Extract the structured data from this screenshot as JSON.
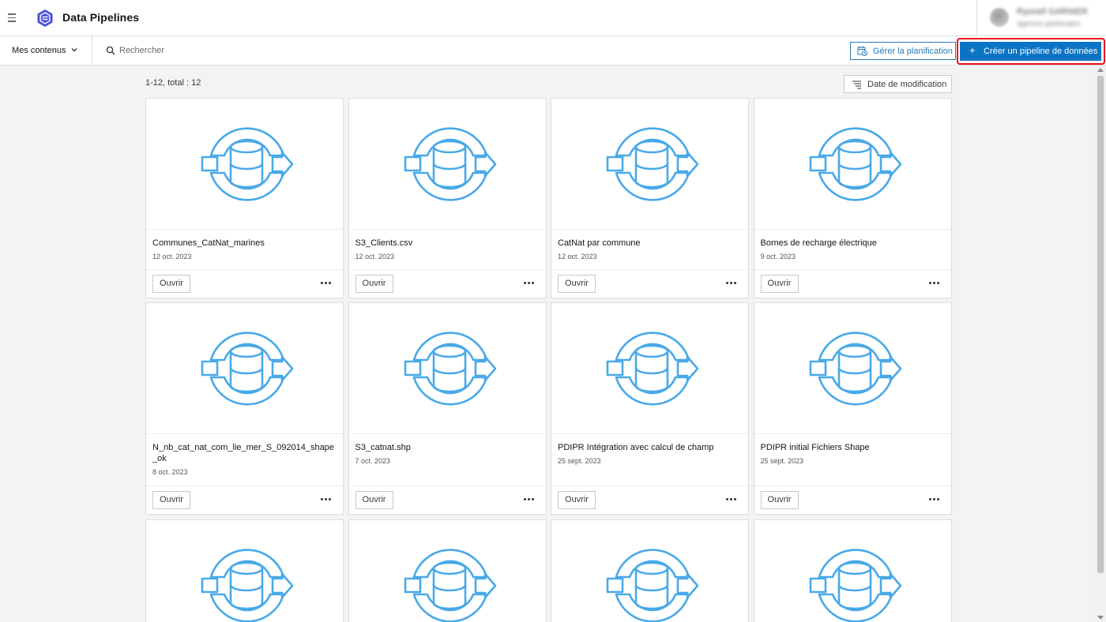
{
  "app": {
    "title": "Data Pipelines",
    "logo_icon": "data-pipelines-hexagon-icon",
    "brand_color": "#4b4fd6"
  },
  "user": {
    "name": "Ryonell GARNIER",
    "subtitle": "agence.partenaire"
  },
  "toolbar": {
    "content_filter": "Mes contenus",
    "search_placeholder": "Rechercher",
    "search_value": "",
    "manage_schedule_label": "Gérer la planification",
    "create_label": "Créer un pipeline de données",
    "accent_color": "#0c74c4",
    "highlight_color": "#e8111a"
  },
  "results": {
    "count_text": "1-12, total : 12",
    "sort_label": "Date de modification"
  },
  "card_actions": {
    "open_label": "Ouvrir",
    "more_icon": "ellipsis-icon",
    "thumbnail_icon": "data-pipeline-icon",
    "icon_color": "#49a9e8"
  },
  "pipelines": [
    {
      "title": "Communes_CatNat_marines",
      "date": "12 oct. 2023"
    },
    {
      "title": "S3_Clients.csv",
      "date": "12 oct. 2023"
    },
    {
      "title": "CatNat par commune",
      "date": "12 oct. 2023"
    },
    {
      "title": "Bornes de recharge électrique",
      "date": "9 oct. 2023"
    },
    {
      "title": "N_nb_cat_nat_com_lie_mer_S_092014_shape_ok",
      "date": "8 oct. 2023"
    },
    {
      "title": "S3_catnat.shp",
      "date": "7 oct. 2023"
    },
    {
      "title": "PDIPR Intégration avec calcul de champ",
      "date": "25 sept. 2023"
    },
    {
      "title": "PDIPR initial Fichiers Shape",
      "date": "25 sept. 2023"
    },
    {
      "title": "",
      "date": ""
    },
    {
      "title": "",
      "date": ""
    },
    {
      "title": "",
      "date": ""
    },
    {
      "title": "",
      "date": ""
    }
  ]
}
